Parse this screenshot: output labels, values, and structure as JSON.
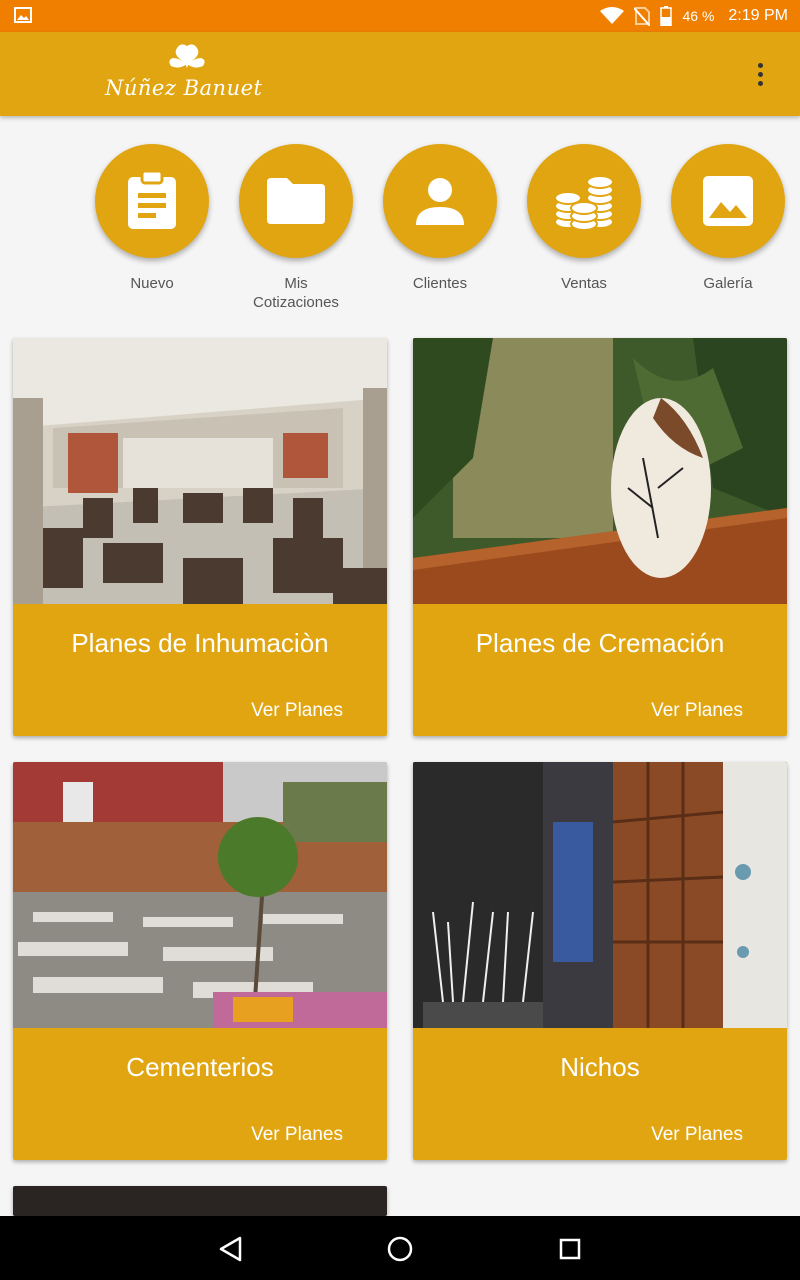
{
  "status_bar": {
    "battery": "46 %",
    "time": "2:19 PM"
  },
  "app_bar": {
    "logo_text": "Núñez Banuet",
    "menu_icon": "more-vert-icon"
  },
  "quick_actions": [
    {
      "label": "Nuevo",
      "icon": "clipboard-icon"
    },
    {
      "label": "Mis\nCotizaciones",
      "icon": "folder-icon"
    },
    {
      "label": "Clientes",
      "icon": "person-icon"
    },
    {
      "label": "Ventas",
      "icon": "coins-icon"
    },
    {
      "label": "Galería",
      "icon": "image-icon"
    }
  ],
  "cards": [
    {
      "title": "Planes de Inhumaciòn",
      "action": "Ver Planes",
      "photo": "lounge-interior"
    },
    {
      "title": "Planes de Cremación",
      "action": "Ver Planes",
      "photo": "urn-on-table"
    },
    {
      "title": "Cementerios",
      "action": "Ver Planes",
      "photo": "cemetery-garden"
    },
    {
      "title": "Nichos",
      "action": "Ver Planes",
      "photo": "niche-wall"
    }
  ],
  "colors": {
    "accent": "#e0a510",
    "status_bar": "#f07f00",
    "background": "#f5f5f5"
  }
}
